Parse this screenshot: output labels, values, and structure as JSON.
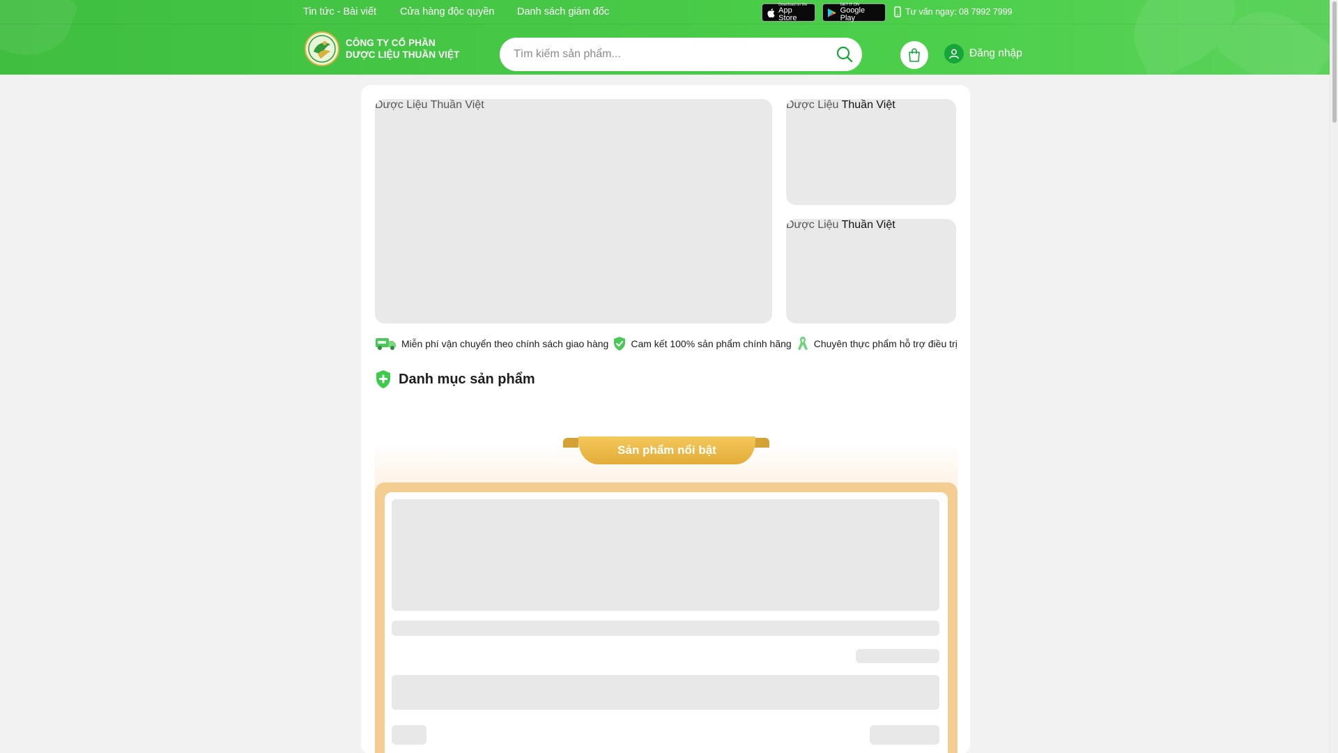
{
  "topbar": {
    "links": [
      "Tin tức - Bài viết",
      "Cửa hàng độc quyền",
      "Danh sách giám đốc"
    ],
    "app_store": {
      "small": "Download on the",
      "big": "App Store"
    },
    "google_play": {
      "small": "GET IT ON",
      "big": "Google Play"
    },
    "hotline": "Tư vấn ngay: 08 7992 7999"
  },
  "logo": {
    "line1": "CÔNG TY CỔ PHẦN",
    "line2": "DƯỢC LIỆU THUẦN VIỆT"
  },
  "search": {
    "placeholder": "Tìm kiếm sản phẩm..."
  },
  "account": {
    "login_label": "Đăng nhập"
  },
  "banners": {
    "main_alt_part1": "Dược Liệu Thuần Việt",
    "side1_alt_part1": "Dược Liệu ",
    "side1_alt_part2": "Thuần Việt",
    "side2_alt_part1": "Dược Liệu ",
    "side2_alt_part2": "Thuần Việt"
  },
  "features": [
    "Miễn phí vận chuyển theo chính sách giao hàng",
    "Cam kết 100% sản phẩm chính hãng",
    "Chuyên thực phẩm hỗ trợ điều trị"
  ],
  "categories": {
    "title": "Danh mục sản phẩm"
  },
  "featured": {
    "title": "Sản phẩm nổi bật"
  },
  "colors": {
    "header_green": "#47c947",
    "accent_green": "#16a63a",
    "gold": "#e3ac38",
    "frame": "#f3cd92"
  },
  "icons": [
    "apple-icon",
    "google-play-icon",
    "phone-icon",
    "search-icon",
    "shopping-bag-icon",
    "user-icon",
    "truck-icon",
    "shield-check-icon",
    "ribbon-icon",
    "plus-shield-icon"
  ]
}
